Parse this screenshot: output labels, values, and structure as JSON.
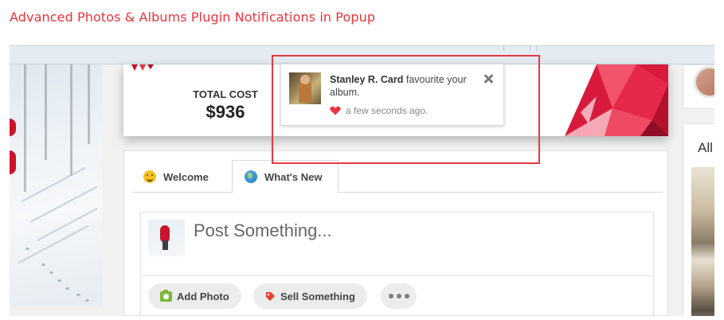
{
  "page_heading": "Advanced Photos & Albums Plugin Notifications in Popup",
  "colors": {
    "heading_red": "#e8343c",
    "highlight_box": "#e53842",
    "heart": "#e53842"
  },
  "cost_card": {
    "label": "TOTAL COST",
    "value": "$936"
  },
  "notification": {
    "user_name": "Stanley R. Card",
    "message": "favourite your album.",
    "time": "a few seconds ago.",
    "close_icon": "close-icon",
    "time_icon": "heart-icon"
  },
  "tabs": [
    {
      "label": "Welcome",
      "icon": "smiley-icon",
      "active": false
    },
    {
      "label": "What's New",
      "icon": "globe-icon",
      "active": true
    }
  ],
  "composer": {
    "placeholder": "Post Something...",
    "buttons": [
      {
        "label": "Add Photo",
        "icon": "camera-icon"
      },
      {
        "label": "Sell Something",
        "icon": "tag-icon"
      },
      {
        "label": "",
        "icon": "more-dots-icon"
      }
    ]
  },
  "right_panel": {
    "heading_partial": "All"
  }
}
